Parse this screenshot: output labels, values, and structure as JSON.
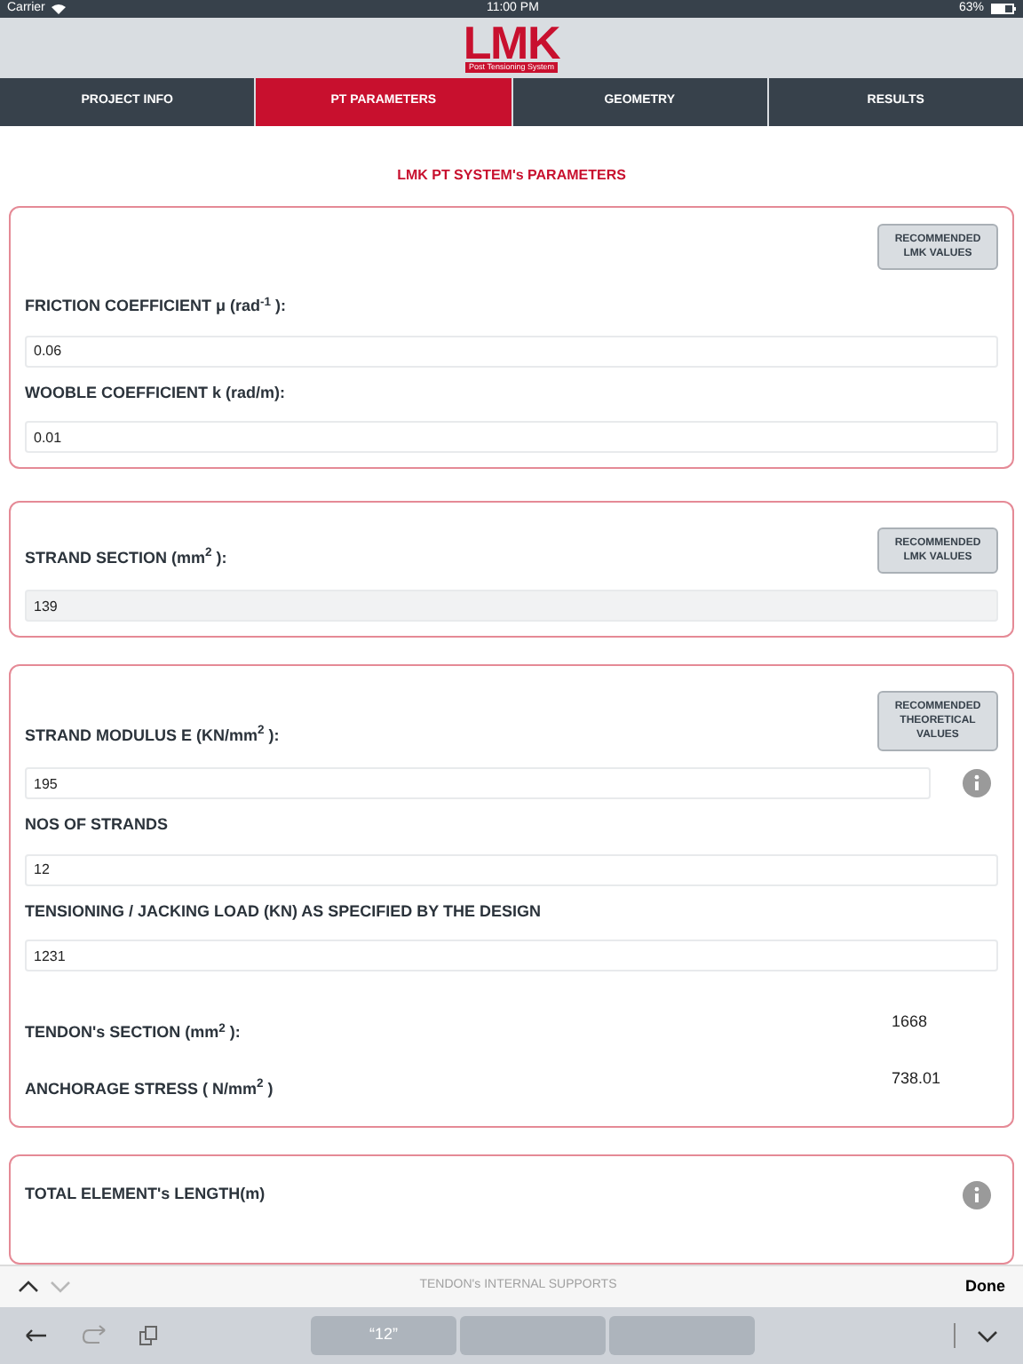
{
  "status_bar": {
    "carrier": "Carrier",
    "time": "11:00 PM",
    "battery": "63%"
  },
  "logo": {
    "text": "LMK",
    "subtitle": "Post Tensioning System"
  },
  "tabs": [
    {
      "label": "PROJECT INFO",
      "selected": false
    },
    {
      "label": "PT PARAMETERS",
      "selected": true
    },
    {
      "label": "GEOMETRY",
      "selected": false
    },
    {
      "label": "RESULTS",
      "selected": false
    }
  ],
  "section_title": "LMK PT SYSTEM's PARAMETERS",
  "cards": [
    {
      "kind": "stacked",
      "button": "RECOMMENDED LMK VALUES",
      "fields": [
        {
          "label": "FRICTION COEFFICIENT μ (rad$^{-1}$ ):",
          "value": "0.06",
          "disabled": false,
          "info": false
        },
        {
          "label": "WOOBLE COEFFICIENT k (rad/m):",
          "value": "0.01",
          "disabled": false,
          "info": false
        }
      ]
    },
    {
      "kind": "inline",
      "button": "RECOMMENDED LMK VALUES",
      "fields": [
        {
          "label": "STRAND SECTION (mm$^{2}$ ):",
          "value": "139",
          "disabled": true,
          "info": false
        }
      ]
    },
    {
      "kind": "inline",
      "button": "RECOMMENDED THEORETICAL VALUES",
      "fields": [
        {
          "label": "STRAND MODULUS E (KN/mm$^{2}$ ):",
          "value": "195",
          "disabled": false,
          "info": true
        },
        {
          "label": "NOS OF STRANDS",
          "value": "12",
          "disabled": false,
          "info": false
        },
        {
          "label": "TENSIONING / JACKING LOAD (KN) AS SPECIFIED BY THE DESIGN",
          "value": "1231",
          "disabled": false,
          "info": false
        }
      ],
      "readouts": [
        {
          "label": "TENDON's SECTION (mm$^{2}$ ):",
          "value": "1668"
        },
        {
          "label": "ANCHORAGE STRESS ( N/mm$^{2}$ )",
          "value": "738.01"
        }
      ]
    },
    {
      "kind": "partial",
      "heading": {
        "label": "TOTAL ELEMENT's LENGTH(m)",
        "info": true
      }
    }
  ],
  "accessory_bar": {
    "prev_disabled": false,
    "next_disabled": true,
    "title": "TENDON's INTERNAL SUPPORTS",
    "done": "Done"
  },
  "shortcut_bar": {
    "suggestions": [
      "“12”"
    ]
  }
}
